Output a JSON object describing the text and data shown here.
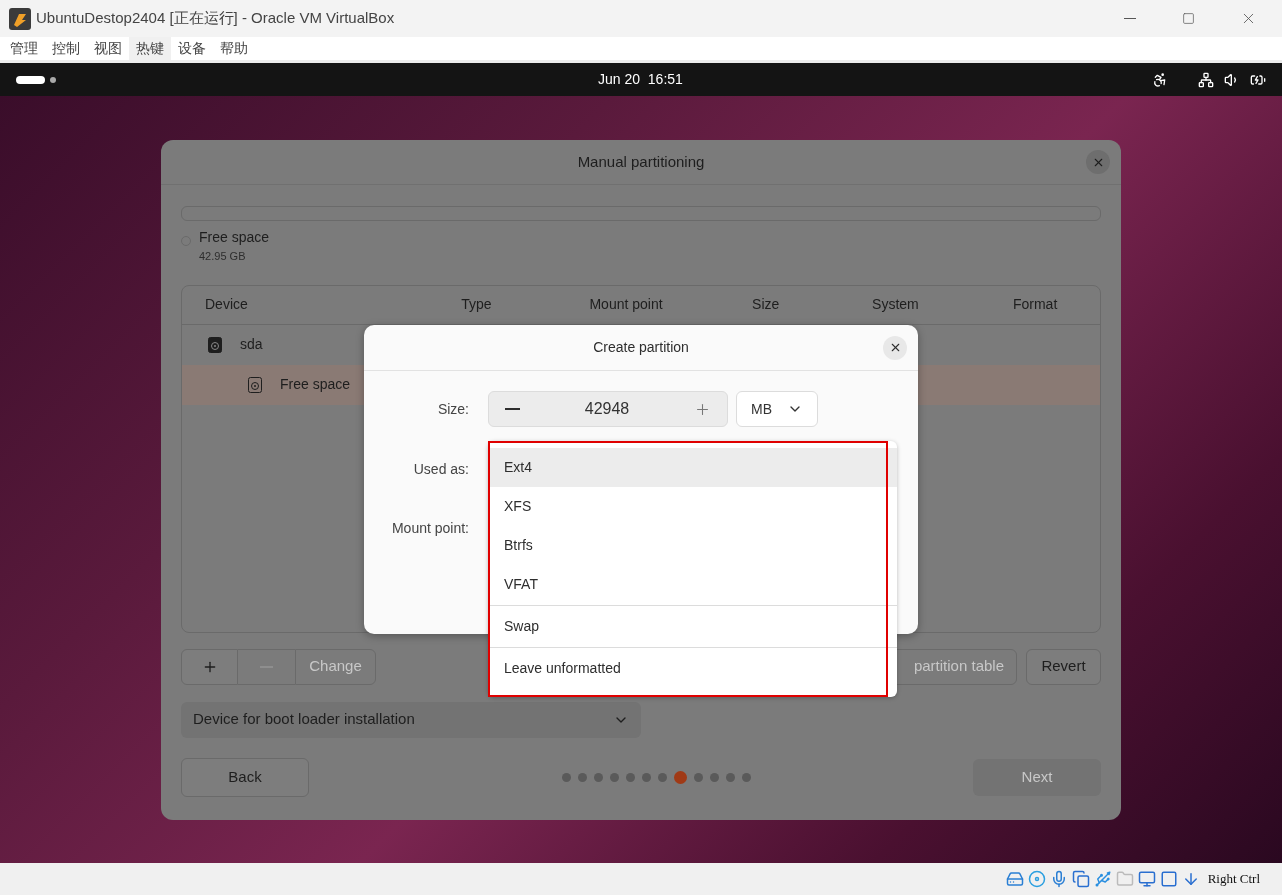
{
  "window": {
    "title": "UbuntuDestop2404 [正在运行] - Oracle VM VirtualBox"
  },
  "menu": [
    {
      "label": "管理",
      "selected": false
    },
    {
      "label": "控制",
      "selected": false
    },
    {
      "label": "视图",
      "selected": false
    },
    {
      "label": "热键",
      "selected": true
    },
    {
      "label": "设备",
      "selected": false
    },
    {
      "label": "帮助",
      "selected": false
    }
  ],
  "top_bar": {
    "clock": "Jun 20  16:51"
  },
  "manual_partitioning": {
    "title": "Manual partitioning",
    "legend": {
      "label": "Free space",
      "size": "42.95 GB"
    },
    "columns": [
      "Device",
      "Type",
      "Mount point",
      "Size",
      "System",
      "Format"
    ],
    "rows": [
      {
        "kind": "disk",
        "device": "sda",
        "selected": false
      },
      {
        "kind": "partition",
        "device": "Free space",
        "selected": true
      }
    ],
    "change": {
      "label": "Change",
      "disabled": true
    },
    "new_table": {
      "label": "partition table",
      "disabled": true
    },
    "revert": {
      "label": "Revert",
      "disabled": false
    },
    "boot_loader": "Device for boot loader installation",
    "back": {
      "label": "Back",
      "disabled": false
    },
    "next": {
      "label": "Next",
      "disabled": true
    },
    "steps": [
      {
        "selected": false
      },
      {
        "selected": false
      },
      {
        "selected": false
      },
      {
        "selected": false
      },
      {
        "selected": false
      },
      {
        "selected": false
      },
      {
        "selected": false
      },
      {
        "selected": true
      },
      {
        "selected": false
      },
      {
        "selected": false
      },
      {
        "selected": false
      },
      {
        "selected": false
      }
    ]
  },
  "create_partition": {
    "title": "Create partition",
    "size_label": "Size:",
    "size_value": "42948",
    "unit": "MB",
    "used_as_label": "Used as:",
    "mount_label": "Mount point:"
  },
  "used_as_menu": {
    "items": [
      {
        "label": "Ext4",
        "selected": true,
        "separator_before": false
      },
      {
        "label": "XFS",
        "selected": false,
        "separator_before": false
      },
      {
        "label": "Btrfs",
        "selected": false,
        "separator_before": false
      },
      {
        "label": "VFAT",
        "selected": false,
        "separator_before": false
      },
      {
        "label": "Swap",
        "selected": false,
        "separator_before": true
      },
      {
        "label": "Leave unformatted",
        "selected": false,
        "separator_before": true
      }
    ]
  },
  "status_bar": {
    "host_key": "Right Ctrl"
  }
}
